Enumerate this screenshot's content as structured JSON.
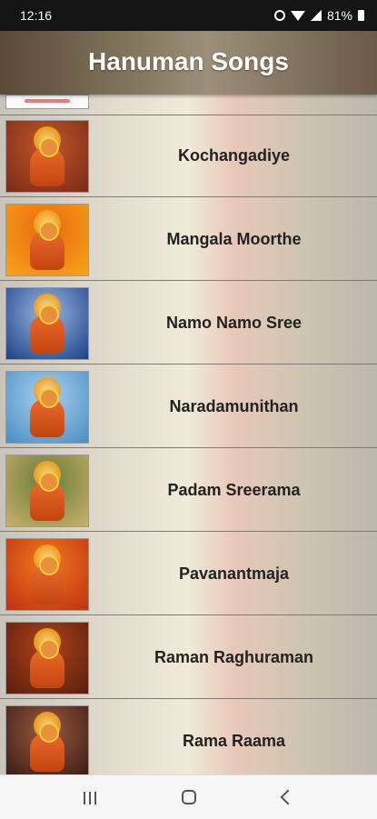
{
  "status_bar": {
    "time": "12:16",
    "battery": "81%"
  },
  "header": {
    "title": "Hanuman Songs"
  },
  "songs": [
    {
      "title": "Kochangadiye",
      "colors": [
        "#7a2a18",
        "#c2562a"
      ]
    },
    {
      "title": "Mangala Moorthe",
      "colors": [
        "#f9a21a",
        "#e86a10"
      ]
    },
    {
      "title": "Namo Namo Sree",
      "colors": [
        "#1c3f8a",
        "#9ab7e0"
      ]
    },
    {
      "title": "Naradamunithan",
      "colors": [
        "#4a8ec4",
        "#a9d0ee"
      ]
    },
    {
      "title": "Padam Sreerama",
      "colors": [
        "#c8b16a",
        "#6a7a3a"
      ]
    },
    {
      "title": "Pavanantmaja",
      "colors": [
        "#c03010",
        "#f07a20"
      ]
    },
    {
      "title": "Raman Raghuraman",
      "colors": [
        "#5a1e0e",
        "#b0421a"
      ]
    },
    {
      "title": "Rama Raama",
      "colors": [
        "#3a1a14",
        "#9a5a40"
      ]
    }
  ]
}
